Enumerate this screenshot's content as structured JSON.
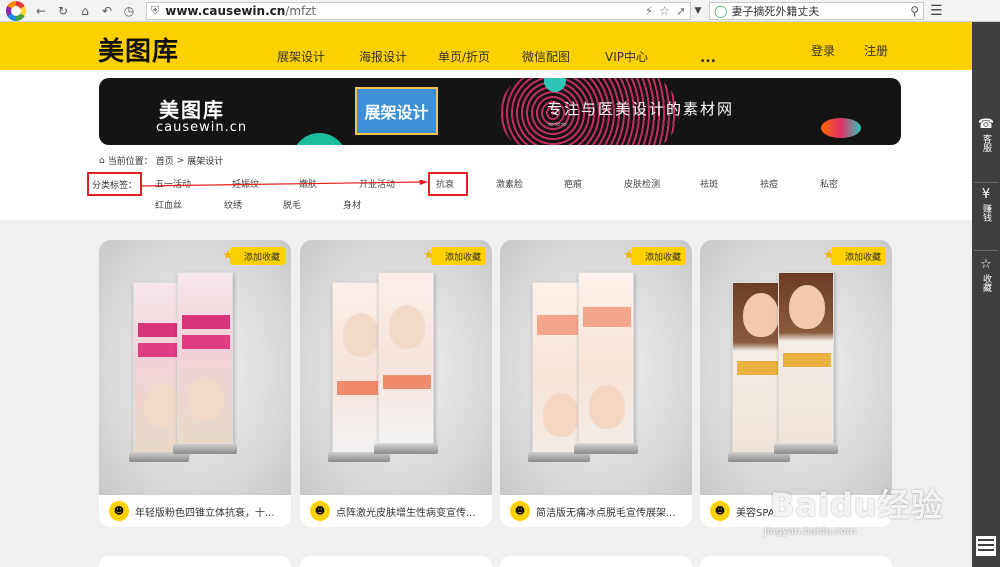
{
  "browser": {
    "url_domain": "www.causewin.cn",
    "url_path": "/mfzt",
    "search_text": "妻子摘死外籍丈夫",
    "colors": {
      "chrome_bg": "#f3f3f3"
    }
  },
  "header": {
    "logo": "美图库",
    "nav": [
      "展架设计",
      "海报设计",
      "单页/折页",
      "微信配图",
      "VIP中心"
    ],
    "more": "...",
    "login": "登录",
    "register": "注册",
    "accent_color": "#fdd100"
  },
  "banner": {
    "brand": "美图库",
    "url": "causewin.cn",
    "card_label": "展架设计",
    "slogan": "专注与医美设计的素材网",
    "waves": "≈≈≈"
  },
  "breadcrumb": {
    "prefix": "当前位置：",
    "home": "首页",
    "sep": ">",
    "current": "展架设计"
  },
  "tags": {
    "label": "分类标签：",
    "row1": [
      "五一活动",
      "妊娠纹",
      "嫩肤",
      "开业活动",
      "抗衰",
      "激素脸",
      "疤痕",
      "皮肤检测",
      "祛斑",
      "祛痘",
      "私密"
    ],
    "row2": [
      "红血丝",
      "纹绣",
      "脱毛",
      "身材"
    ],
    "highlighted": "抗衰"
  },
  "cards": [
    {
      "caption": "年轻版粉色四锥立体抗衰，十...",
      "fav": "添加收藏",
      "theme": "pink"
    },
    {
      "caption": "点阵激光皮肤增生性病变宣传...",
      "fav": "添加收藏",
      "theme": "coral"
    },
    {
      "caption": "简洁版无痛冰点脱毛宣传展架...",
      "fav": "添加收藏",
      "theme": "peach"
    },
    {
      "caption": "美容SPA...",
      "fav": "添加收藏",
      "theme": "brown"
    }
  ],
  "sidebar": {
    "items": [
      {
        "icon": "headset-icon",
        "label": "客服"
      },
      {
        "icon": "money-icon",
        "label": "赚钱"
      },
      {
        "icon": "star-icon",
        "label": "收藏"
      }
    ]
  },
  "watermark": {
    "brand": "Baidu经验",
    "url": "jingyan.baidu.com"
  }
}
